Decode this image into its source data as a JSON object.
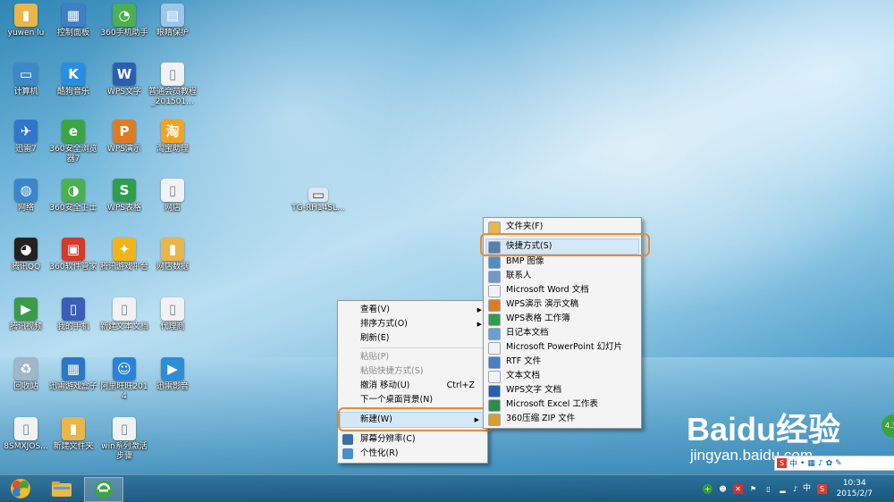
{
  "desktop": {
    "icons": [
      {
        "label": "yuwen lu",
        "icon": "folder-icon",
        "color": "#e8b64a",
        "glyph": "▮"
      },
      {
        "label": "控制面板",
        "icon": "control-panel-icon",
        "color": "#3f7fc4",
        "glyph": "▦"
      },
      {
        "label": "360手机助手",
        "icon": "360-phone-assistant-icon",
        "color": "#4caf50",
        "glyph": "◔"
      },
      {
        "label": "眼睛保护",
        "icon": "eye-care-icon",
        "color": "#9ec6e8",
        "glyph": "▤"
      },
      {
        "label": "计算机",
        "icon": "computer-icon",
        "color": "#3f88c8",
        "glyph": "▭"
      },
      {
        "label": "酷狗音乐",
        "icon": "kugou-music-icon",
        "color": "#2a8de0",
        "glyph": "K"
      },
      {
        "label": "WPS文字",
        "icon": "wps-writer-icon",
        "color": "#2a5fb0",
        "glyph": "W"
      },
      {
        "label": "普通会员教程_201501...",
        "icon": "document-icon",
        "color": "#f2f2f2",
        "glyph": "▯"
      },
      {
        "label": "迅雷7",
        "icon": "xunlei-icon",
        "color": "#2f77c9",
        "glyph": "✈"
      },
      {
        "label": "360安全浏览器7",
        "icon": "360-browser-icon",
        "color": "#3ba545",
        "glyph": "e"
      },
      {
        "label": "WPS演示",
        "icon": "wps-presentation-icon",
        "color": "#e07a22",
        "glyph": "P"
      },
      {
        "label": "淘宝助理",
        "icon": "taobao-assistant-icon",
        "color": "#f4a321",
        "glyph": "淘"
      },
      {
        "label": "网络",
        "icon": "network-icon",
        "color": "#3a86cc",
        "glyph": "◍"
      },
      {
        "label": "360安全卫士",
        "icon": "360-security-icon",
        "color": "#4caf50",
        "glyph": "◑"
      },
      {
        "label": "WPS表格",
        "icon": "wps-spreadsheet-icon",
        "color": "#2e9e4a",
        "glyph": "S"
      },
      {
        "label": "网店",
        "icon": "document-icon",
        "color": "#f2f2f2",
        "glyph": "▯"
      },
      {
        "label": "腾讯QQ",
        "icon": "qq-icon",
        "color": "#222222",
        "glyph": "◕"
      },
      {
        "label": "360软件管家",
        "icon": "360-software-manager-icon",
        "color": "#d33a2c",
        "glyph": "▣"
      },
      {
        "label": "腾讯游戏平台",
        "icon": "tencent-game-icon",
        "color": "#f1b51c",
        "glyph": "✦"
      },
      {
        "label": "网店数据",
        "icon": "folder-icon",
        "color": "#e8b64a",
        "glyph": "▮"
      },
      {
        "label": "腾讯视频",
        "icon": "tencent-video-icon",
        "color": "#3a9b4a",
        "glyph": "▶"
      },
      {
        "label": "我的手机",
        "icon": "my-phone-icon",
        "color": "#3b5fb8",
        "glyph": "▯"
      },
      {
        "label": "新建文本文档",
        "icon": "text-document-icon",
        "color": "#f2f2f2",
        "glyph": "▯"
      },
      {
        "label": "代理商",
        "icon": "document-icon",
        "color": "#f2f2f2",
        "glyph": "▯"
      },
      {
        "label": "回收站",
        "icon": "recycle-bin-icon",
        "color": "#9fb7c9",
        "glyph": "♻"
      },
      {
        "label": "迅雷游戏盒子",
        "icon": "xunlei-game-box-icon",
        "color": "#2b78c4",
        "glyph": "▦"
      },
      {
        "label": "阿里旺旺2014",
        "icon": "aliwangwang-icon",
        "color": "#2a83d8",
        "glyph": "☺"
      },
      {
        "label": "迅雷影音",
        "icon": "xunlei-player-icon",
        "color": "#2d8ed6",
        "glyph": "▶"
      },
      {
        "label": "8SMXJOS...",
        "icon": "document-icon",
        "color": "#f2f2f2",
        "glyph": "▯"
      },
      {
        "label": "新建文件夹",
        "icon": "folder-icon",
        "color": "#e8b64a",
        "glyph": "▮"
      },
      {
        "label": "win系列激活步骤",
        "icon": "text-document-icon",
        "color": "#f2f2f2",
        "glyph": "▯"
      }
    ],
    "dragged_icon": {
      "label": "TG-RH14SL...",
      "icon": "printer-icon"
    }
  },
  "context_menu": {
    "items": [
      {
        "label": "查看(V)",
        "submenu": true,
        "disabled": false
      },
      {
        "label": "排序方式(O)",
        "submenu": true,
        "disabled": false
      },
      {
        "label": "刷新(E)",
        "submenu": false,
        "disabled": false
      },
      {
        "label": "粘贴(P)",
        "submenu": false,
        "disabled": true
      },
      {
        "label": "粘贴快捷方式(S)",
        "submenu": false,
        "disabled": true
      },
      {
        "label": "撤消 移动(U)",
        "submenu": false,
        "disabled": false,
        "shortcut": "Ctrl+Z"
      },
      {
        "label": "下一个桌面背景(N)",
        "submenu": false,
        "disabled": false
      },
      {
        "label": "新建(W)",
        "submenu": true,
        "disabled": false,
        "highlighted": true
      },
      {
        "label": "屏幕分辨率(C)",
        "submenu": false,
        "disabled": false
      },
      {
        "label": "个性化(R)",
        "submenu": false,
        "disabled": false
      }
    ]
  },
  "new_submenu": {
    "items": [
      {
        "label": "文件夹(F)",
        "icon": "folder-icon",
        "color": "#e8b64a"
      },
      {
        "label": "快捷方式(S)",
        "icon": "shortcut-icon",
        "color": "#5a7fa8",
        "highlighted": true
      },
      {
        "label": "BMP 图像",
        "icon": "bmp-image-icon",
        "color": "#4a8fc8"
      },
      {
        "label": "联系人",
        "icon": "contact-icon",
        "color": "#6c9bc7"
      },
      {
        "label": "Microsoft Word 文档",
        "icon": "word-document-icon",
        "color": "#f2f2f2"
      },
      {
        "label": "WPS演示 演示文稿",
        "icon": "wps-presentation-icon",
        "color": "#e07a22"
      },
      {
        "label": "WPS表格 工作簿",
        "icon": "wps-spreadsheet-icon",
        "color": "#2e9e4a"
      },
      {
        "label": "日记本文档",
        "icon": "journal-icon",
        "color": "#6aa0d0"
      },
      {
        "label": "Microsoft PowerPoint 幻灯片",
        "icon": "powerpoint-icon",
        "color": "#f2f2f2"
      },
      {
        "label": "RTF 文件",
        "icon": "rtf-icon",
        "color": "#4a7fc0"
      },
      {
        "label": "文本文档",
        "icon": "text-document-icon",
        "color": "#f2f2f2"
      },
      {
        "label": "WPS文字 文档",
        "icon": "wps-writer-icon",
        "color": "#2a5fb0"
      },
      {
        "label": "Microsoft Excel 工作表",
        "icon": "excel-icon",
        "color": "#2e8b4a"
      },
      {
        "label": "360压缩 ZIP 文件",
        "icon": "zip-icon",
        "color": "#d8a02a"
      }
    ]
  },
  "taskbar": {
    "apps": [
      {
        "name": "start-orb",
        "icon": "windows-start-icon"
      },
      {
        "name": "file-explorer",
        "icon": "folder-icon"
      },
      {
        "name": "360-browser",
        "icon": "360-browser-icon"
      }
    ],
    "tray": {
      "ime_label": "中",
      "time": "10:34",
      "date": "2015/2/7"
    }
  },
  "watermark": {
    "brand": "Baidu经验",
    "url": "jingyan.baidu.com"
  },
  "ime_toolbar": {
    "label": "中"
  },
  "side_widget": {
    "text": "4.3"
  }
}
